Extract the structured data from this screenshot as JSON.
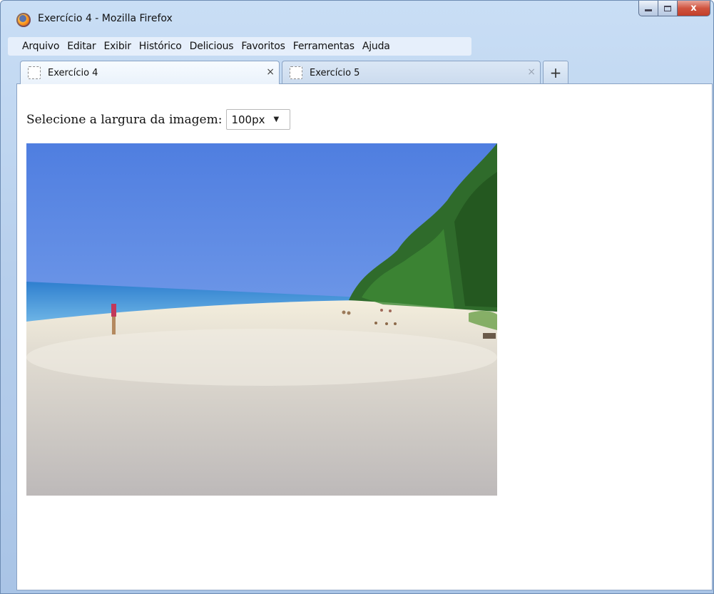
{
  "window": {
    "title": "Exercício 4 - Mozilla Firefox",
    "app_icon": "firefox-icon",
    "controls": {
      "minimize": "minimize-icon",
      "maximize": "maximize-icon",
      "close_label": "x"
    }
  },
  "menubar": {
    "items": [
      {
        "label": "Arquivo"
      },
      {
        "label": "Editar"
      },
      {
        "label": "Exibir"
      },
      {
        "label": "Histórico"
      },
      {
        "label": "Delicious"
      },
      {
        "label": "Favoritos"
      },
      {
        "label": "Ferramentas"
      },
      {
        "label": "Ajuda"
      }
    ]
  },
  "tabs": [
    {
      "label": "Exercício 4",
      "active": true,
      "close": "×"
    },
    {
      "label": "Exercício 5",
      "active": false,
      "close": "×"
    }
  ],
  "new_tab": "+",
  "page": {
    "select_label": "Selecione a largura da imagem:",
    "select_value": "100px",
    "select_arrow": "▼",
    "image": "beach-photo"
  },
  "colors": {
    "sky": "#5b86e0",
    "sea": "#3d8fd4",
    "sand": "#cfcbc8",
    "trees": "#2e6b2a"
  }
}
